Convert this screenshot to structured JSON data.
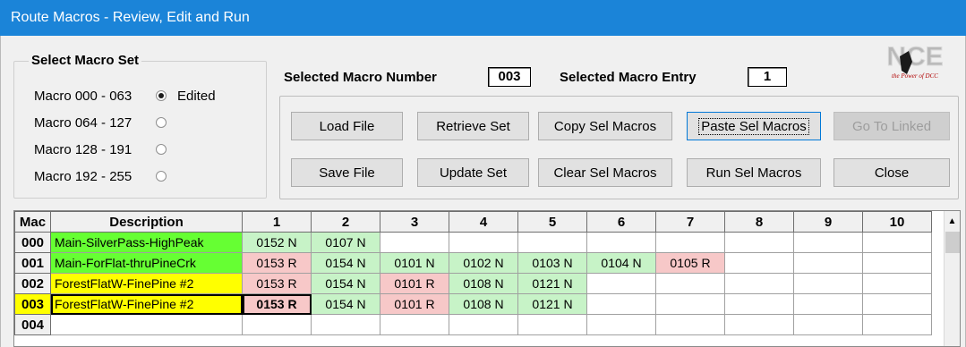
{
  "window": {
    "title": "Route Macros - Review, Edit and Run"
  },
  "macro_set": {
    "title": "Select Macro Set",
    "options": [
      {
        "label": "Macro 000 - 063",
        "checked": true,
        "extra": "Edited"
      },
      {
        "label": "Macro 064 - 127",
        "checked": false,
        "extra": ""
      },
      {
        "label": "Macro 128 - 191",
        "checked": false,
        "extra": ""
      },
      {
        "label": "Macro 192 - 255",
        "checked": false,
        "extra": ""
      }
    ]
  },
  "selected": {
    "macro_number_label": "Selected Macro Number",
    "macro_number": "003",
    "macro_entry_label": "Selected Macro Entry",
    "macro_entry": "1"
  },
  "logo": {
    "text": "NCE",
    "subtitle": "the Power of DCC"
  },
  "buttons": {
    "load_file": "Load File",
    "retrieve_set": "Retrieve Set",
    "copy_sel": "Copy Sel Macros",
    "paste_sel": "Paste Sel Macros",
    "go_linked": "Go To Linked",
    "save_file": "Save File",
    "update_set": "Update Set",
    "clear_sel": "Clear Sel Macros",
    "run_sel": "Run Sel Macros",
    "close": "Close"
  },
  "grid": {
    "headers": [
      "Mac",
      "Description",
      "1",
      "2",
      "3",
      "4",
      "5",
      "6",
      "7",
      "8",
      "9",
      "10"
    ],
    "rows": [
      {
        "mac": "000",
        "desc": "Main-SilverPass-HighPeak",
        "desc_color": "green",
        "entries": [
          "0152 N",
          "0107 N",
          "",
          "",
          "",
          "",
          "",
          "",
          "",
          ""
        ]
      },
      {
        "mac": "001",
        "desc": "Main-ForFlat-thruPineCrk",
        "desc_color": "green",
        "entries": [
          "0153 R",
          "0154 N",
          "0101 N",
          "0102 N",
          "0103 N",
          "0104 N",
          "0105 R",
          "",
          "",
          ""
        ]
      },
      {
        "mac": "002",
        "desc": "ForestFlatW-FinePine #2",
        "desc_color": "yellow",
        "entries": [
          "0153 R",
          "0154 N",
          "0101 R",
          "0108 N",
          "0121 N",
          "",
          "",
          "",
          "",
          ""
        ]
      },
      {
        "mac": "003",
        "desc": "ForestFlatW-FinePine #2",
        "desc_color": "yellow",
        "selected": true,
        "entries": [
          "0153 R",
          "0154 N",
          "0101 R",
          "0108 N",
          "0121 N",
          "",
          "",
          "",
          "",
          ""
        ]
      },
      {
        "mac": "004",
        "desc": "",
        "desc_color": "white",
        "entries": [
          "",
          "",
          "",
          "",
          "",
          "",
          "",
          "",
          "",
          ""
        ]
      }
    ]
  }
}
